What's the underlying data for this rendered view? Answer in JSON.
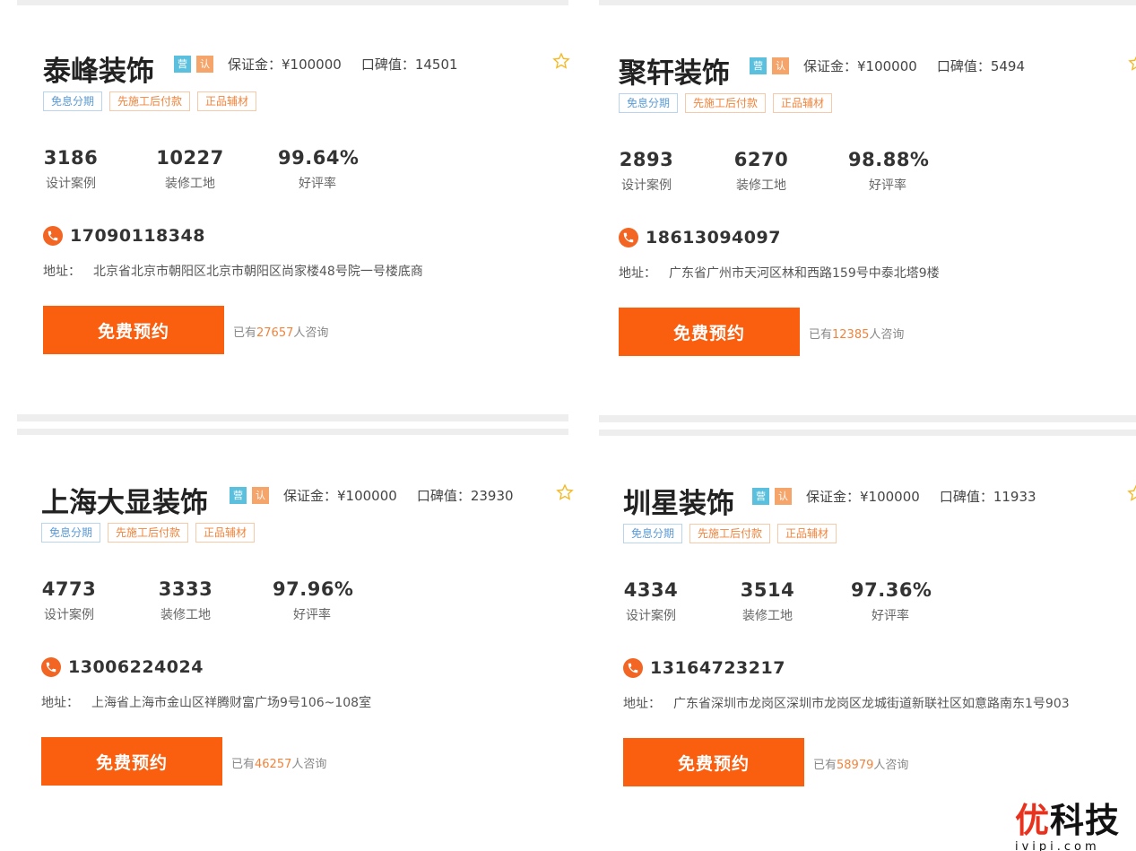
{
  "cards": [
    {
      "name": "泰峰装饰",
      "badge_ying": "营",
      "badge_ren": "认",
      "deposit": "保证金：¥100000",
      "reputation": "口碑值：14501",
      "tags": [
        "免息分期",
        "先施工后付款",
        "正品辅材"
      ],
      "stats": [
        {
          "value": "3186",
          "label": "设计案例"
        },
        {
          "value": "10227",
          "label": "装修工地"
        },
        {
          "value": "99.64%",
          "label": "好评率"
        }
      ],
      "phone": "17090118348",
      "address_label": "地址：",
      "address": "北京省北京市朝阳区北京市朝阳区尚家楼48号院一号楼底商",
      "button": "免费预约",
      "consult_prefix": "已有",
      "consult_count": "27657",
      "consult_suffix": "人咨询"
    },
    {
      "name": "聚轩装饰",
      "badge_ying": "营",
      "badge_ren": "认",
      "deposit": "保证金：¥100000",
      "reputation": "口碑值：5494",
      "tags": [
        "免息分期",
        "先施工后付款",
        "正品辅材"
      ],
      "stats": [
        {
          "value": "2893",
          "label": "设计案例"
        },
        {
          "value": "6270",
          "label": "装修工地"
        },
        {
          "value": "98.88%",
          "label": "好评率"
        }
      ],
      "phone": "18613094097",
      "address_label": "地址：",
      "address": "广东省广州市天河区林和西路159号中泰北塔9楼",
      "button": "免费预约",
      "consult_prefix": "已有",
      "consult_count": "12385",
      "consult_suffix": "人咨询"
    },
    {
      "name": "上海大显装饰",
      "badge_ying": "营",
      "badge_ren": "认",
      "deposit": "保证金：¥100000",
      "reputation": "口碑值：23930",
      "tags": [
        "免息分期",
        "先施工后付款",
        "正品辅材"
      ],
      "stats": [
        {
          "value": "4773",
          "label": "设计案例"
        },
        {
          "value": "3333",
          "label": "装修工地"
        },
        {
          "value": "97.96%",
          "label": "好评率"
        }
      ],
      "phone": "13006224024",
      "address_label": "地址：",
      "address": "上海省上海市金山区祥腾财富广场9号106~108室",
      "button": "免费预约",
      "consult_prefix": "已有",
      "consult_count": "46257",
      "consult_suffix": "人咨询"
    },
    {
      "name": "圳星装饰",
      "badge_ying": "营",
      "badge_ren": "认",
      "deposit": "保证金：¥100000",
      "reputation": "口碑值：11933",
      "tags": [
        "免息分期",
        "先施工后付款",
        "正品辅材"
      ],
      "stats": [
        {
          "value": "4334",
          "label": "设计案例"
        },
        {
          "value": "3514",
          "label": "装修工地"
        },
        {
          "value": "97.36%",
          "label": "好评率"
        }
      ],
      "phone": "13164723217",
      "address_label": "地址：",
      "address": "广东省深圳市龙岗区深圳市龙岗区龙城街道新联社区如意路南东1号903",
      "button": "免费预约",
      "consult_prefix": "已有",
      "consult_count": "58979",
      "consult_suffix": "人咨询"
    }
  ],
  "watermark": {
    "cn_first": "优",
    "cn_rest": "科技",
    "en": "ivipi.com"
  },
  "colors": {
    "accent": "#fa5f0f",
    "phone_icon": "#f26522",
    "badge_ying": "#5bc0de",
    "badge_ren": "#f5a46a",
    "tag_blue": "#5b9bd5",
    "tag_orange": "#f0843c",
    "star": "#f5b820"
  }
}
